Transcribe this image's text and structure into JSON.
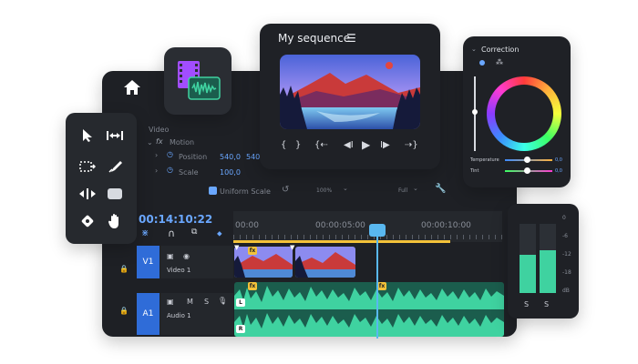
{
  "monitor": {
    "title": "My sequence",
    "menu_icon": "hamburger-icon"
  },
  "effects": {
    "section": "Video",
    "motion_label": "Motion",
    "position_label": "Position",
    "position_x": "540,0",
    "position_y": "540,",
    "scale_label": "Scale",
    "scale_value": "100,0",
    "uniform_scale": "Uniform Scale",
    "zoom": "100%",
    "quality": "Full"
  },
  "correction": {
    "title": "Correction",
    "temperature_label": "Temperature",
    "temperature_value": "0,0",
    "tint_label": "Tint",
    "tint_value": "0,0"
  },
  "timeline": {
    "timecode": "00:14:10:22",
    "ruler": [
      "00:00",
      "00:00:05:00",
      "00:00:10:00"
    ],
    "video_track": {
      "id": "V1",
      "name": "Video 1"
    },
    "audio_track": {
      "id": "A1",
      "name": "Audio 1",
      "mute": "M",
      "solo": "S"
    },
    "fx_label": "fx",
    "left_channel": "L",
    "right_channel": "R"
  },
  "meters": {
    "db_labels": [
      "0",
      "-6",
      "-12",
      "-18",
      "dB"
    ],
    "solo_left": "S",
    "solo_right": "S",
    "levels": [
      0.55,
      0.62
    ]
  },
  "colors": {
    "accent": "#6aa7ff",
    "track_blue": "#2f6cd8",
    "audio_green": "#3fd2a0",
    "playhead": "#59b8f0",
    "fx_badge": "#f3c23a"
  }
}
